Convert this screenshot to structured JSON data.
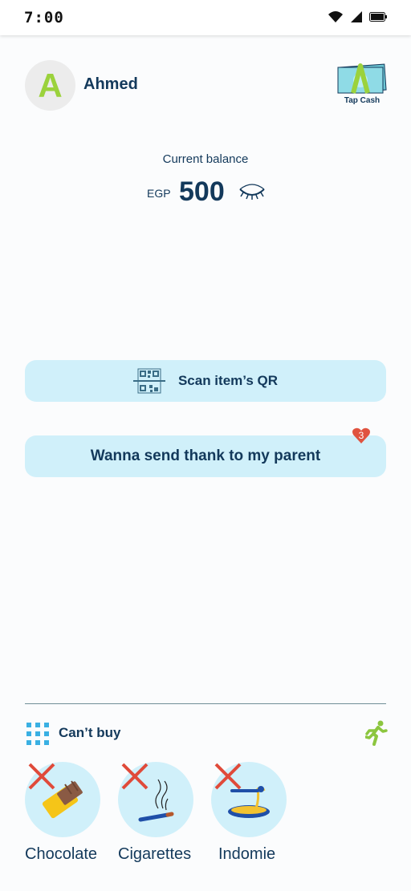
{
  "status_bar": {
    "time": "7:00",
    "icons": [
      "wifi-icon",
      "signal-icon",
      "battery-icon"
    ]
  },
  "user": {
    "initial": "A",
    "name": "Ahmed"
  },
  "tapcash": {
    "label": "Tap Cash"
  },
  "balance": {
    "label": "Current balance",
    "currency": "EGP",
    "amount": "500"
  },
  "actions": {
    "scan_label": "Scan item’s QR",
    "thanks_label": "Wanna send thank to my parent",
    "thanks_badge": "3"
  },
  "restrictions": {
    "title": "Can’t buy",
    "items": [
      {
        "label": "Chocolate",
        "icon": "chocolate-icon"
      },
      {
        "label": "Cigarettes",
        "icon": "cigarette-icon"
      },
      {
        "label": "Indomie",
        "icon": "noodles-icon"
      }
    ]
  },
  "colors": {
    "accent": "#9bd23c",
    "primary": "#13395b",
    "pill": "#d0f0fa",
    "badge": "#e0533f"
  }
}
